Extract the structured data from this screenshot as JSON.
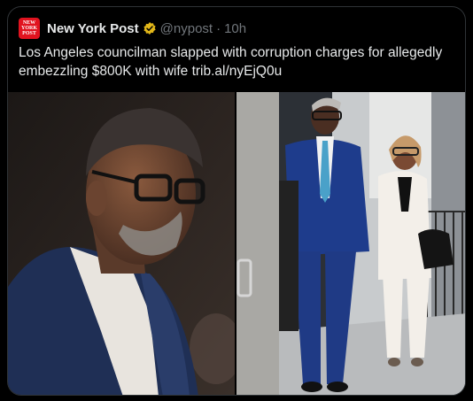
{
  "tweet": {
    "author_name": "New York Post",
    "handle": "@nypost",
    "separator": "·",
    "time": "10h",
    "text": "Los Angeles councilman slapped with corruption charges for allegedly embezzling $800K with wife trib.al/nyEjQ0u",
    "avatar_lines": [
      "NEW",
      "YORK",
      "POST"
    ]
  },
  "colors": {
    "brand_red": "#e1131f",
    "verified_gold": "#e2b719",
    "muted_text": "#71767b"
  }
}
